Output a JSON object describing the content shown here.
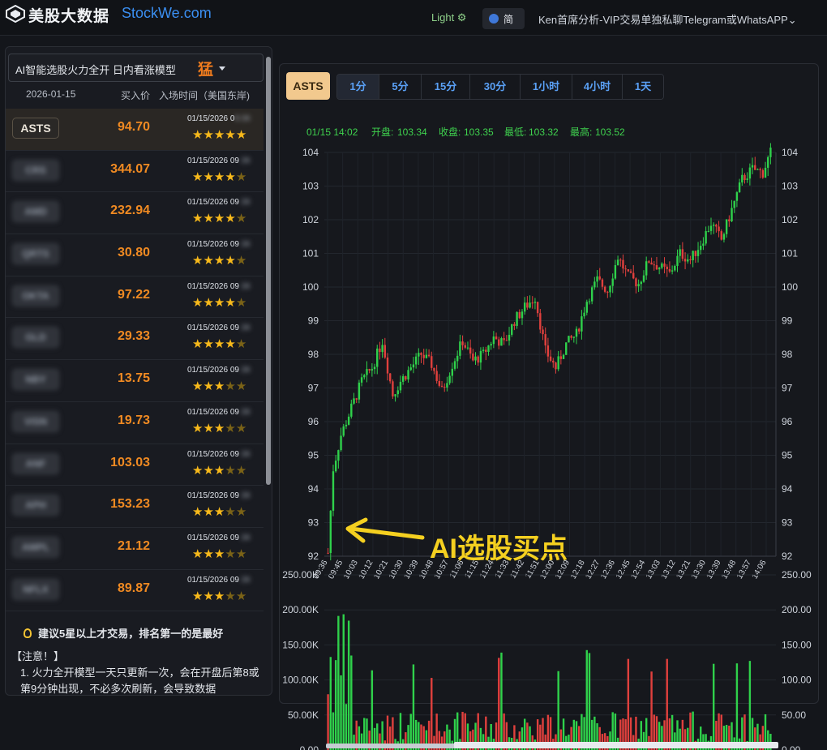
{
  "header": {
    "logo_cn": "美股大数据",
    "logo_en": "StockWe.com",
    "theme_label": "Light ⚙",
    "lang_label": "简",
    "promo_text": "Ken首席分析-VIP交易单独私聊Telegram或WhatsAPP",
    "promo_caret": "⌄"
  },
  "sidebar": {
    "model_label": "AI智能选股火力全开 日内看涨模型",
    "model_badge": "猛",
    "date": "2026-01-15",
    "col_price": "买入价",
    "col_time": "入场时间（美国东岸)",
    "rows": [
      {
        "ticker": "ASTS",
        "price": "94.70",
        "time_visible": "01/15/2026 0",
        "time_hidden": "9:36",
        "stars": 5
      },
      {
        "ticker": "CRS",
        "price": "344.07",
        "time_visible": "01/15/2026 09",
        "time_hidden": ":36",
        "stars": 4
      },
      {
        "ticker": "AMD",
        "price": "232.94",
        "time_visible": "01/15/2026 09",
        "time_hidden": ":36",
        "stars": 4
      },
      {
        "ticker": "QRTS",
        "price": "30.80",
        "time_visible": "01/15/2026 09",
        "time_hidden": ":36",
        "stars": 4
      },
      {
        "ticker": "OKTA",
        "price": "97.22",
        "time_visible": "01/15/2026 09",
        "time_hidden": ":36",
        "stars": 4
      },
      {
        "ticker": "GLD",
        "price": "29.33",
        "time_visible": "01/15/2026 09",
        "time_hidden": ":36",
        "stars": 4
      },
      {
        "ticker": "NBY",
        "price": "13.75",
        "time_visible": "01/15/2026 09",
        "time_hidden": ":36",
        "stars": 3
      },
      {
        "ticker": "VISN",
        "price": "19.73",
        "time_visible": "01/15/2026 09",
        "time_hidden": ":36",
        "stars": 3
      },
      {
        "ticker": "ANF",
        "price": "103.03",
        "time_visible": "01/15/2026 09",
        "time_hidden": ":36",
        "stars": 3
      },
      {
        "ticker": "APH",
        "price": "153.23",
        "time_visible": "01/15/2026 09",
        "time_hidden": ":36",
        "stars": 3
      },
      {
        "ticker": "AMPL",
        "price": "21.12",
        "time_visible": "01/15/2026 09",
        "time_hidden": ":36",
        "stars": 3
      },
      {
        "ticker": "NFLX",
        "price": "89.87",
        "time_visible": "01/15/2026 09",
        "time_hidden": ":36",
        "stars": 3
      }
    ],
    "tip": "建议5星以上才交易，排名第一的是最好",
    "notice_title": "【注意！】",
    "notice_body": "1. 火力全开模型一天只更新一次，会在开盘后第8或第9分钟出现，不必多次刷新，会导致数据"
  },
  "toolbar": {
    "symbol": "ASTS",
    "timeframes": [
      "1分",
      "5分",
      "15分",
      "30分",
      "1小时",
      "4小时",
      "1天"
    ],
    "selected": "1分"
  },
  "chart_data": {
    "type": "candlestick",
    "symbol": "ASTS",
    "info": {
      "time": "01/15 14:02",
      "open_label": "开盘:",
      "open": "103.34",
      "close_label": "收盘:",
      "close": "103.35",
      "low_label": "最低:",
      "low": "103.32",
      "high_label": "最高:",
      "high": "103.52"
    },
    "ylim": [
      92,
      104
    ],
    "yticks": [
      "92",
      "93",
      "94",
      "95",
      "96",
      "97",
      "98",
      "99",
      "100",
      "101",
      "102",
      "103",
      "104"
    ],
    "xticks": [
      "09:36",
      "09:45",
      "10:03",
      "10:12",
      "10:21",
      "10:30",
      "10:39",
      "10:48",
      "10:57",
      "11:06",
      "11:15",
      "11:24",
      "11:33",
      "11:42",
      "11:51",
      "12:00",
      "12:09",
      "12:18",
      "12:27",
      "12:36",
      "12:45",
      "12:54",
      "13:03",
      "13:12",
      "13:21",
      "13:30",
      "13:39",
      "13:48",
      "13:57",
      "14:06"
    ],
    "price_path": [
      [
        0,
        92.1
      ],
      [
        2,
        94.6
      ],
      [
        5,
        95.6
      ],
      [
        9,
        96.4
      ],
      [
        13,
        97.2
      ],
      [
        17,
        97.6
      ],
      [
        21,
        98.4
      ],
      [
        25,
        96.8
      ],
      [
        28,
        97.2
      ],
      [
        32,
        97.6
      ],
      [
        36,
        98.0
      ],
      [
        40,
        97.7
      ],
      [
        44,
        96.9
      ],
      [
        48,
        97.7
      ],
      [
        52,
        98.4
      ],
      [
        56,
        97.8
      ],
      [
        60,
        98.0
      ],
      [
        64,
        98.5
      ],
      [
        68,
        98.3
      ],
      [
        72,
        99.0
      ],
      [
        76,
        99.4
      ],
      [
        80,
        99.7
      ],
      [
        84,
        98.1
      ],
      [
        88,
        97.6
      ],
      [
        92,
        98.3
      ],
      [
        96,
        98.6
      ],
      [
        100,
        99.6
      ],
      [
        104,
        100.2
      ],
      [
        108,
        99.9
      ],
      [
        112,
        100.9
      ],
      [
        116,
        100.3
      ],
      [
        120,
        100.1
      ],
      [
        124,
        100.8
      ],
      [
        128,
        100.6
      ],
      [
        132,
        100.4
      ],
      [
        136,
        101.0
      ],
      [
        140,
        100.8
      ],
      [
        144,
        101.3
      ],
      [
        148,
        101.9
      ],
      [
        152,
        101.4
      ],
      [
        156,
        102.3
      ],
      [
        160,
        103.2
      ],
      [
        164,
        103.5
      ],
      [
        168,
        103.4
      ],
      [
        171,
        104.0
      ]
    ],
    "volume_ylim": [
      0,
      250000
    ],
    "volume_left_ticks": [
      "0.00",
      "50.00K",
      "100.00K",
      "150.00K",
      "200.00K",
      "250.00K"
    ],
    "volume_right_ticks": [
      "0.00",
      "50.00",
      "100.00",
      "150.00",
      "200.00",
      "250.00"
    ],
    "annotation": "AI选股买点",
    "colors": {
      "up": "#2fd14b",
      "down": "#e0403d",
      "annotation": "#f5d020",
      "info": "#3fd24e",
      "axis": "#cfd4dc"
    }
  }
}
